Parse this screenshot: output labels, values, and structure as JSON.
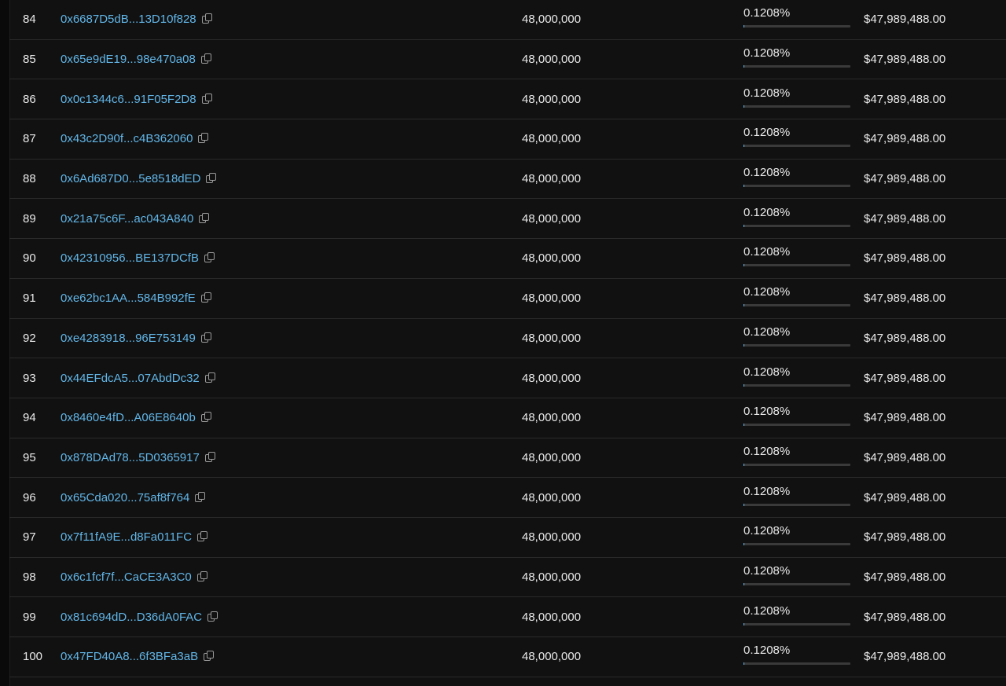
{
  "colors": {
    "background": "#111111",
    "link": "#62b6e8",
    "text": "#eaeaea",
    "divider": "#2a2a2a",
    "bar_track": "#3a3a3a"
  },
  "icons": {
    "copy": "copy-icon"
  },
  "holders": [
    {
      "rank": "84",
      "address": "0x6687D5dB...13D10f828",
      "quantity": "48,000,000",
      "percentage": "0.1208%",
      "percentage_value": 0.1208,
      "value": "$47,989,488.00"
    },
    {
      "rank": "85",
      "address": "0x65e9dE19...98e470a08",
      "quantity": "48,000,000",
      "percentage": "0.1208%",
      "percentage_value": 0.1208,
      "value": "$47,989,488.00"
    },
    {
      "rank": "86",
      "address": "0x0c1344c6...91F05F2D8",
      "quantity": "48,000,000",
      "percentage": "0.1208%",
      "percentage_value": 0.1208,
      "value": "$47,989,488.00"
    },
    {
      "rank": "87",
      "address": "0x43c2D90f...c4B362060",
      "quantity": "48,000,000",
      "percentage": "0.1208%",
      "percentage_value": 0.1208,
      "value": "$47,989,488.00"
    },
    {
      "rank": "88",
      "address": "0x6Ad687D0...5e8518dED",
      "quantity": "48,000,000",
      "percentage": "0.1208%",
      "percentage_value": 0.1208,
      "value": "$47,989,488.00"
    },
    {
      "rank": "89",
      "address": "0x21a75c6F...ac043A840",
      "quantity": "48,000,000",
      "percentage": "0.1208%",
      "percentage_value": 0.1208,
      "value": "$47,989,488.00"
    },
    {
      "rank": "90",
      "address": "0x42310956...BE137DCfB",
      "quantity": "48,000,000",
      "percentage": "0.1208%",
      "percentage_value": 0.1208,
      "value": "$47,989,488.00"
    },
    {
      "rank": "91",
      "address": "0xe62bc1AA...584B992fE",
      "quantity": "48,000,000",
      "percentage": "0.1208%",
      "percentage_value": 0.1208,
      "value": "$47,989,488.00"
    },
    {
      "rank": "92",
      "address": "0xe4283918...96E753149",
      "quantity": "48,000,000",
      "percentage": "0.1208%",
      "percentage_value": 0.1208,
      "value": "$47,989,488.00"
    },
    {
      "rank": "93",
      "address": "0x44EFdcA5...07AbdDc32",
      "quantity": "48,000,000",
      "percentage": "0.1208%",
      "percentage_value": 0.1208,
      "value": "$47,989,488.00"
    },
    {
      "rank": "94",
      "address": "0x8460e4fD...A06E8640b",
      "quantity": "48,000,000",
      "percentage": "0.1208%",
      "percentage_value": 0.1208,
      "value": "$47,989,488.00"
    },
    {
      "rank": "95",
      "address": "0x878DAd78...5D0365917",
      "quantity": "48,000,000",
      "percentage": "0.1208%",
      "percentage_value": 0.1208,
      "value": "$47,989,488.00"
    },
    {
      "rank": "96",
      "address": "0x65Cda020...75af8f764",
      "quantity": "48,000,000",
      "percentage": "0.1208%",
      "percentage_value": 0.1208,
      "value": "$47,989,488.00"
    },
    {
      "rank": "97",
      "address": "0x7f11fA9E...d8Fa011FC",
      "quantity": "48,000,000",
      "percentage": "0.1208%",
      "percentage_value": 0.1208,
      "value": "$47,989,488.00"
    },
    {
      "rank": "98",
      "address": "0x6c1fcf7f...CaCE3A3C0",
      "quantity": "48,000,000",
      "percentage": "0.1208%",
      "percentage_value": 0.1208,
      "value": "$47,989,488.00"
    },
    {
      "rank": "99",
      "address": "0x81c694dD...D36dA0FAC",
      "quantity": "48,000,000",
      "percentage": "0.1208%",
      "percentage_value": 0.1208,
      "value": "$47,989,488.00"
    },
    {
      "rank": "100",
      "address": "0x47FD40A8...6f3BFa3aB",
      "quantity": "48,000,000",
      "percentage": "0.1208%",
      "percentage_value": 0.1208,
      "value": "$47,989,488.00"
    }
  ]
}
